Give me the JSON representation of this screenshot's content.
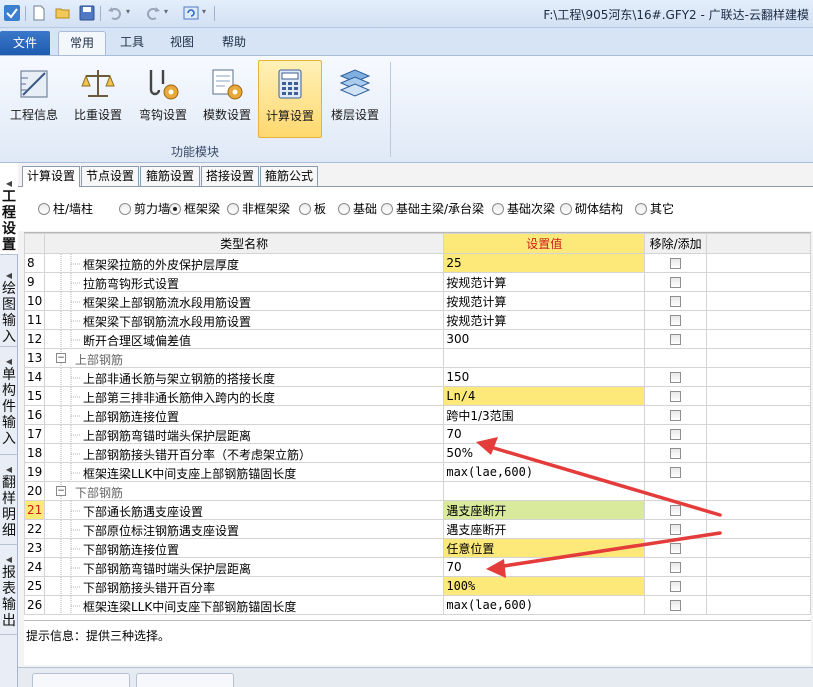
{
  "window": {
    "title": "F:\\工程\\905河东\\16#.GFY2 - 广联达-云翻样建模"
  },
  "quick_access": {
    "icons": [
      "app-logo-icon",
      "new-file-icon",
      "open-folder-icon",
      "save-icon",
      "undo-icon",
      "redo-icon",
      "refresh-icon"
    ]
  },
  "ribbon": {
    "file_label": "文件",
    "tabs": [
      {
        "label": "常用",
        "active": true
      },
      {
        "label": "工具",
        "active": false
      },
      {
        "label": "视图",
        "active": false
      },
      {
        "label": "帮助",
        "active": false
      }
    ],
    "buttons": [
      {
        "label": "工程信息",
        "icon": "ruler-drafting-icon"
      },
      {
        "label": "比重设置",
        "icon": "balance-scale-icon"
      },
      {
        "label": "弯钩设置",
        "icon": "hook-gear-icon"
      },
      {
        "label": "模数设置",
        "icon": "module-gear-icon"
      },
      {
        "label": "计算设置",
        "icon": "calculator-icon",
        "active": true
      },
      {
        "label": "楼层设置",
        "icon": "floor-layers-icon"
      }
    ],
    "group_label": "功能模块"
  },
  "left_nav": {
    "tabs": [
      {
        "label": "工程设置",
        "active": true
      },
      {
        "label": "绘图输入",
        "active": false
      },
      {
        "label": "单构件输入",
        "active": false
      },
      {
        "label": "翻样明细",
        "active": false
      },
      {
        "label": "报表输出",
        "active": false
      }
    ]
  },
  "sub_tabs": [
    {
      "label": "计算设置",
      "active": true
    },
    {
      "label": "节点设置",
      "active": false
    },
    {
      "label": "箍筋设置",
      "active": false
    },
    {
      "label": "搭接设置",
      "active": false
    },
    {
      "label": "箍筋公式",
      "active": false
    }
  ],
  "component_types": {
    "selected": "框架梁",
    "options": [
      "柱/墙柱",
      "剪力墙",
      "框架梁",
      "非框架梁",
      "板",
      "基础",
      "基础主梁/承台梁",
      "基础次梁",
      "砌体结构",
      "其它"
    ]
  },
  "grid": {
    "headers": {
      "type_name": "类型名称",
      "value": "设置值",
      "remove_add": "移除/添加"
    },
    "highlight_color": "#fde97a",
    "rows": [
      {
        "num": "8",
        "name": "框架梁拉筋的外皮保护层厚度",
        "value": "25",
        "kind": "item",
        "value_style": "yellow",
        "checkbox": true
      },
      {
        "num": "9",
        "name": "拉筋弯钩形式设置",
        "value": "按规范计算",
        "kind": "item",
        "value_style": "none",
        "checkbox": true
      },
      {
        "num": "10",
        "name": "框架梁上部钢筋流水段用筋设置",
        "value": "按规范计算",
        "kind": "item",
        "value_style": "none",
        "checkbox": true
      },
      {
        "num": "11",
        "name": "框架梁下部钢筋流水段用筋设置",
        "value": "按规范计算",
        "kind": "item",
        "value_style": "none",
        "checkbox": true
      },
      {
        "num": "12",
        "name": "断开合理区域偏差值",
        "value": "300",
        "kind": "item",
        "value_style": "none",
        "checkbox": true
      },
      {
        "num": "13",
        "name": "上部钢筋",
        "value": "",
        "kind": "group",
        "value_style": "none",
        "checkbox": false
      },
      {
        "num": "14",
        "name": "上部非通长筋与架立钢筋的搭接长度",
        "value": "150",
        "kind": "item",
        "value_style": "none",
        "checkbox": true
      },
      {
        "num": "15",
        "name": "上部第三排非通长筋伸入跨内的长度",
        "value": "Ln/4",
        "kind": "item",
        "value_style": "yellow-mono",
        "checkbox": true
      },
      {
        "num": "16",
        "name": "上部钢筋连接位置",
        "value": "跨中1/3范围",
        "kind": "item",
        "value_style": "none",
        "checkbox": true
      },
      {
        "num": "17",
        "name": "上部钢筋弯锚时端头保护层距离",
        "value": "70",
        "kind": "item",
        "value_style": "none",
        "checkbox": true
      },
      {
        "num": "18",
        "name": "上部钢筋接头错开百分率（不考虑架立筋）",
        "value": "50%",
        "kind": "item",
        "value_style": "none",
        "checkbox": true
      },
      {
        "num": "19",
        "name": "框架连梁LLK中间支座上部钢筋锚固长度",
        "value": "max(lae,600)",
        "kind": "item",
        "value_style": "mono",
        "checkbox": true
      },
      {
        "num": "20",
        "name": "下部钢筋",
        "value": "",
        "kind": "group",
        "value_style": "none",
        "checkbox": false
      },
      {
        "num": "21",
        "name": "下部通长筋遇支座设置",
        "value": "遇支座断开",
        "kind": "item",
        "value_style": "green",
        "checkbox": true,
        "selected": true
      },
      {
        "num": "22",
        "name": "下部原位标注钢筋遇支座设置",
        "value": "遇支座断开",
        "kind": "item",
        "value_style": "none",
        "checkbox": true
      },
      {
        "num": "23",
        "name": "下部钢筋连接位置",
        "value": "任意位置",
        "kind": "item",
        "value_style": "yellow",
        "checkbox": true
      },
      {
        "num": "24",
        "name": "下部钢筋弯锚时端头保护层距离",
        "value": "70",
        "kind": "item",
        "value_style": "none",
        "checkbox": true
      },
      {
        "num": "25",
        "name": "下部钢筋接头错开百分率",
        "value": "100%",
        "kind": "item",
        "value_style": "yellow-mono",
        "checkbox": true
      },
      {
        "num": "26",
        "name": "框架连梁LLK中间支座下部钢筋锚固长度",
        "value": "max(lae,600)",
        "kind": "item",
        "value_style": "mono",
        "checkbox": true
      }
    ]
  },
  "tip": {
    "text": "提示信息：提供三种选择。"
  },
  "annotation": {
    "arrow_color": "#e43b3b"
  }
}
